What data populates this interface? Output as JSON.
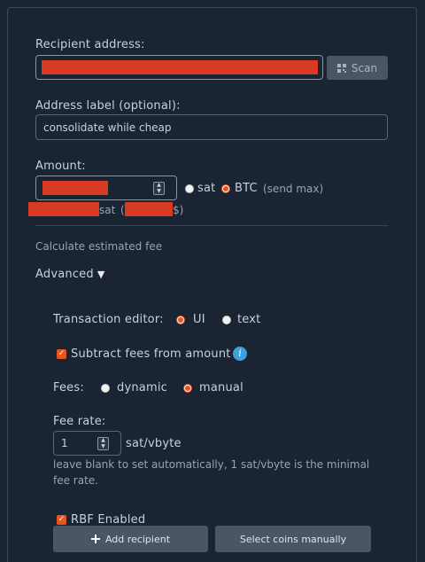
{
  "recipient": {
    "label": "Recipient address:",
    "scan_label": "Scan",
    "scan_icon": "qr-code-icon"
  },
  "address_label": {
    "label": "Address label (optional):",
    "value": "consolidate while cheap"
  },
  "amount": {
    "label": "Amount:",
    "unit_sat": "sat",
    "unit_btc": "BTC",
    "selected_unit": "BTC",
    "send_max": "(send max)",
    "sat_suffix": "sat",
    "fiat_open": "(",
    "fiat_suffix": "$)"
  },
  "fee_estimate": {
    "label": "Calculate estimated fee"
  },
  "advanced": {
    "label": "Advanced",
    "arrow": "▼",
    "editor": {
      "label": "Transaction editor:",
      "option_ui": "UI",
      "option_text": "text",
      "selected": "UI"
    },
    "subtract_fees": {
      "label": "Subtract fees from amount",
      "checked": true,
      "info_glyph": "i"
    },
    "fees": {
      "label": "Fees:",
      "option_dynamic": "dynamic",
      "option_manual": "manual",
      "selected": "manual"
    },
    "fee_rate": {
      "label": "Fee rate:",
      "value": "1",
      "unit": "sat/vbyte",
      "help_line1": "leave blank to set automatically, 1 sat/vbyte is the minimal",
      "help_line2": "fee rate."
    },
    "rbf": {
      "label": "RBF Enabled",
      "checked": true
    }
  },
  "actions": {
    "add_recipient": "Add recipient",
    "add_icon": "plus-icon",
    "select_coins": "Select coins manually"
  },
  "colors": {
    "accent": "#e8541f",
    "redaction": "#d93a24",
    "info": "#3fa0e0",
    "background": "#1b2432"
  }
}
